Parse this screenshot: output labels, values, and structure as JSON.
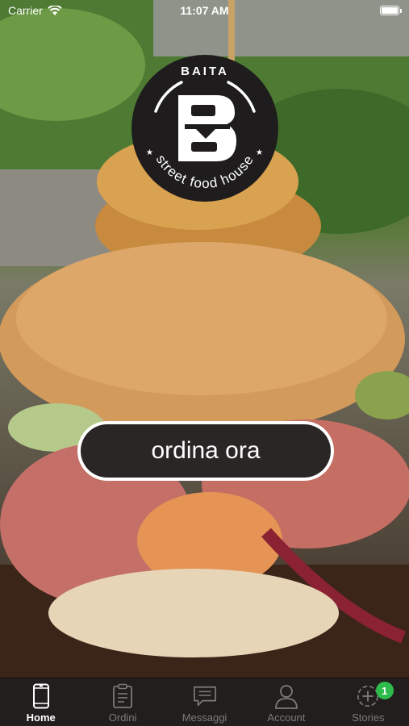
{
  "status_bar": {
    "carrier": "Carrier",
    "time": "11:07 AM"
  },
  "logo": {
    "top_text": "BAITA",
    "arc_text": "street food house"
  },
  "hero": {
    "cta_label": "ordina ora"
  },
  "tab_bar": {
    "tabs": [
      {
        "label": "Home",
        "icon": "phone-icon",
        "active": true
      },
      {
        "label": "Ordini",
        "icon": "clipboard-icon",
        "active": false
      },
      {
        "label": "Messaggi",
        "icon": "chat-icon",
        "active": false
      },
      {
        "label": "Account",
        "icon": "user-icon",
        "active": false
      },
      {
        "label": "Stories",
        "icon": "add-circle-icon",
        "active": false,
        "badge": "1"
      }
    ]
  },
  "colors": {
    "tab_bar_bg": "#221e1e",
    "badge": "#2dbb4c",
    "button_bg": "#2a2626",
    "logo_bg": "#1e1c1d"
  }
}
